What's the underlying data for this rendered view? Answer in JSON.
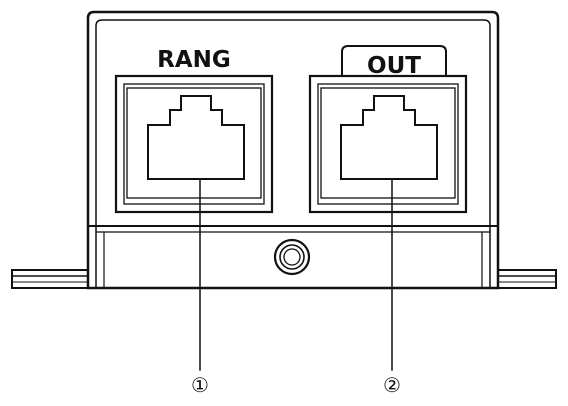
{
  "ports": [
    {
      "label": "RANG",
      "callout": "①"
    },
    {
      "label": "OUT",
      "callout": "②"
    }
  ]
}
